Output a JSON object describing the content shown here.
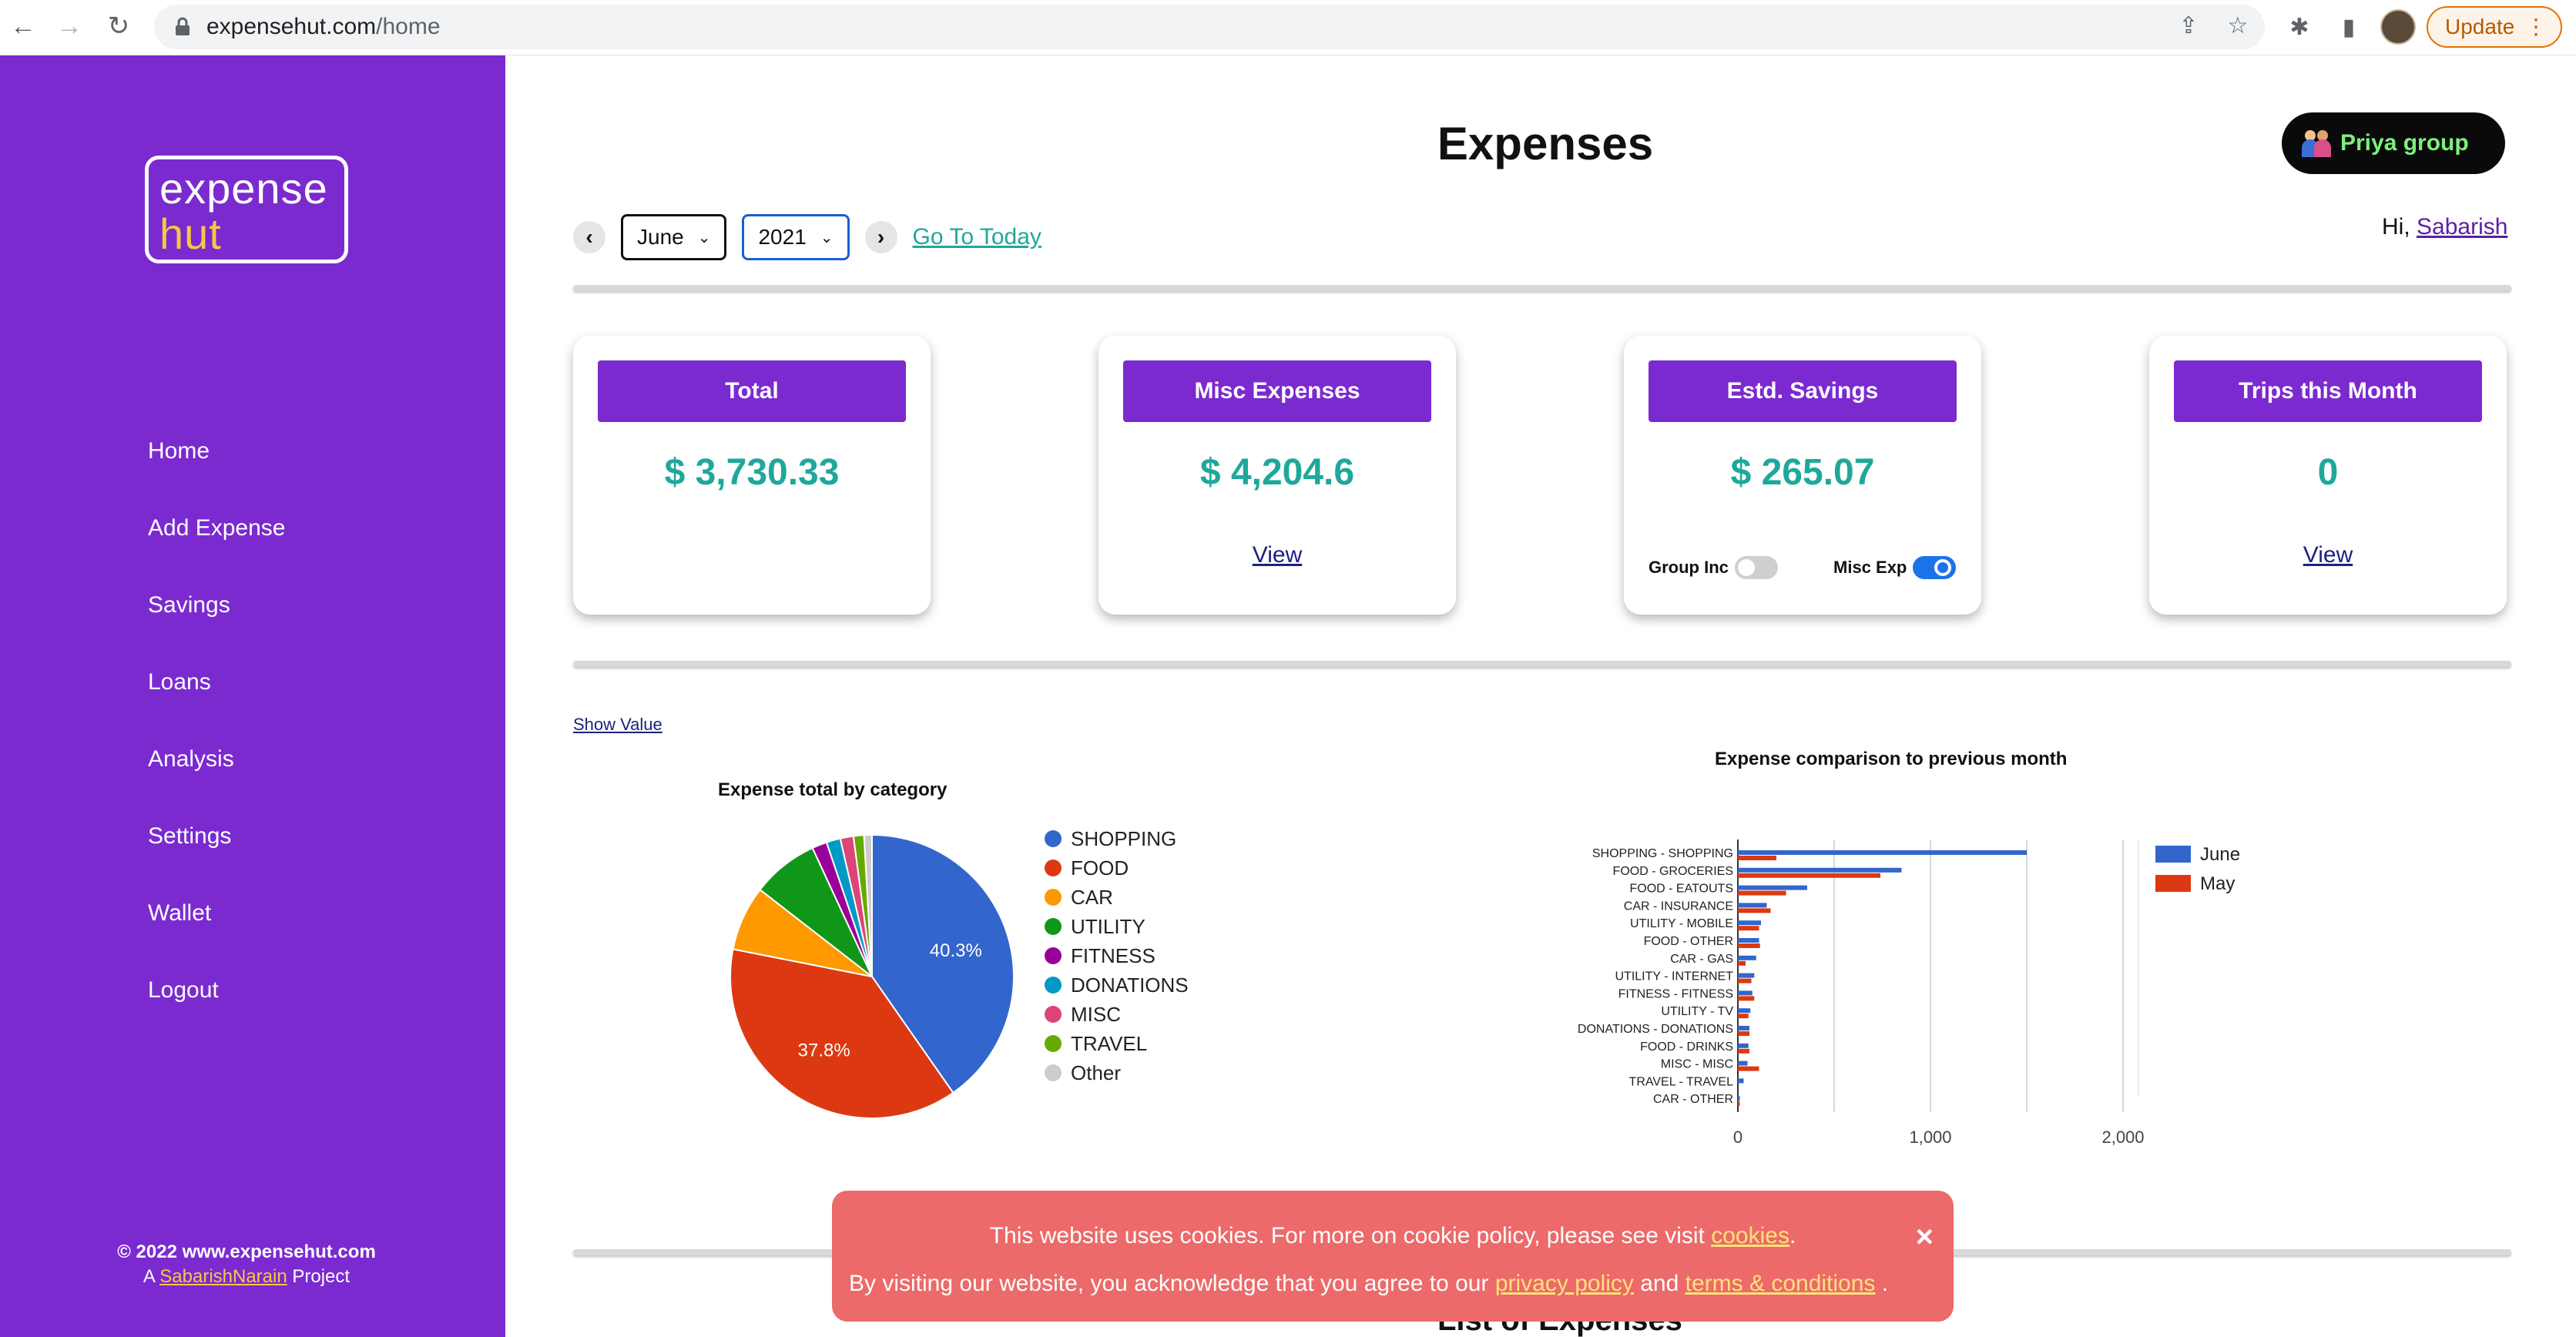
{
  "browser": {
    "url_host": "expensehut.com",
    "url_path": "/home",
    "update_label": "Update"
  },
  "sidebar": {
    "logo_top": "expense",
    "logo_bottom": "hut",
    "items": [
      {
        "label": "Home"
      },
      {
        "label": "Add Expense"
      },
      {
        "label": "Savings"
      },
      {
        "label": "Loans"
      },
      {
        "label": "Analysis"
      },
      {
        "label": "Settings"
      },
      {
        "label": "Wallet"
      },
      {
        "label": "Logout"
      }
    ],
    "footer_copy": "© 2022 www.expensehut.com",
    "footer_prefix": "A",
    "footer_link": "SabarishNarain",
    "footer_suffix": "Project"
  },
  "header": {
    "title": "Expenses",
    "group_label": "Priya group",
    "greeting": "Hi,",
    "user": "Sabarish"
  },
  "date_nav": {
    "month": "June",
    "year": "2021",
    "goto_label": "Go To Today"
  },
  "cards": [
    {
      "title": "Total",
      "value": "$ 3,730.33",
      "link": ""
    },
    {
      "title": "Misc Expenses",
      "value": "$ 4,204.6",
      "link": "View"
    },
    {
      "title": "Estd. Savings",
      "value": "$ 265.07",
      "link": ""
    },
    {
      "title": "Trips this Month",
      "value": "0",
      "link": "View"
    }
  ],
  "toggles": {
    "group_inc_label": "Group Inc",
    "group_inc_on": false,
    "misc_exp_label": "Misc Exp",
    "misc_exp_on": true
  },
  "show_value_label": "Show Value",
  "chart_data": [
    {
      "type": "pie",
      "title": "Expense total by category",
      "categories": [
        "SHOPPING",
        "FOOD",
        "CAR",
        "UTILITY",
        "FITNESS",
        "DONATIONS",
        "MISC",
        "TRAVEL",
        "Other"
      ],
      "values": [
        40.3,
        37.8,
        7.4,
        7.6,
        1.7,
        1.6,
        1.5,
        1.2,
        0.9
      ],
      "colors": [
        "#3366cc",
        "#dc3912",
        "#ff9900",
        "#109618",
        "#990099",
        "#0099c6",
        "#dd4477",
        "#66aa00",
        "#cccccc"
      ],
      "slice_labels": [
        "40.3%",
        "37.8%"
      ]
    },
    {
      "type": "bar",
      "orientation": "horizontal",
      "title": "Expense comparison to previous month",
      "categories": [
        "SHOPPING - SHOPPING",
        "FOOD - GROCERIES",
        "FOOD - EATOUTS",
        "CAR - INSURANCE",
        "UTILITY - MOBILE",
        "FOOD - OTHER",
        "CAR - GAS",
        "UTILITY - INTERNET",
        "FITNESS - FITNESS",
        "UTILITY - TV",
        "DONATIONS - DONATIONS",
        "FOOD - DRINKS",
        "MISC - MISC",
        "TRAVEL - TRAVEL",
        "CAR - OTHER"
      ],
      "series": [
        {
          "name": "June",
          "color": "#3366cc",
          "values": [
            1500,
            850,
            360,
            150,
            120,
            110,
            95,
            85,
            75,
            65,
            60,
            55,
            50,
            30,
            10
          ]
        },
        {
          "name": "May",
          "color": "#dc3912",
          "values": [
            200,
            740,
            250,
            170,
            110,
            115,
            40,
            70,
            85,
            55,
            60,
            60,
            110,
            0,
            10
          ]
        }
      ],
      "x_ticks": [
        "0",
        "1,000",
        "2,000"
      ],
      "xlim": [
        0,
        2000
      ]
    }
  ],
  "cookie": {
    "line1_text": "This website uses cookies. For more on cookie policy, please see visit",
    "line1_link": "cookies",
    "line1_end": ".",
    "line2_text": "By visiting our website, you acknowledge that you agree to our",
    "privacy_link": "privacy policy",
    "and_text": "and",
    "terms_link": "terms & conditions",
    "line2_end": ".",
    "close_label": "×"
  },
  "list_title": "List of Expenses"
}
